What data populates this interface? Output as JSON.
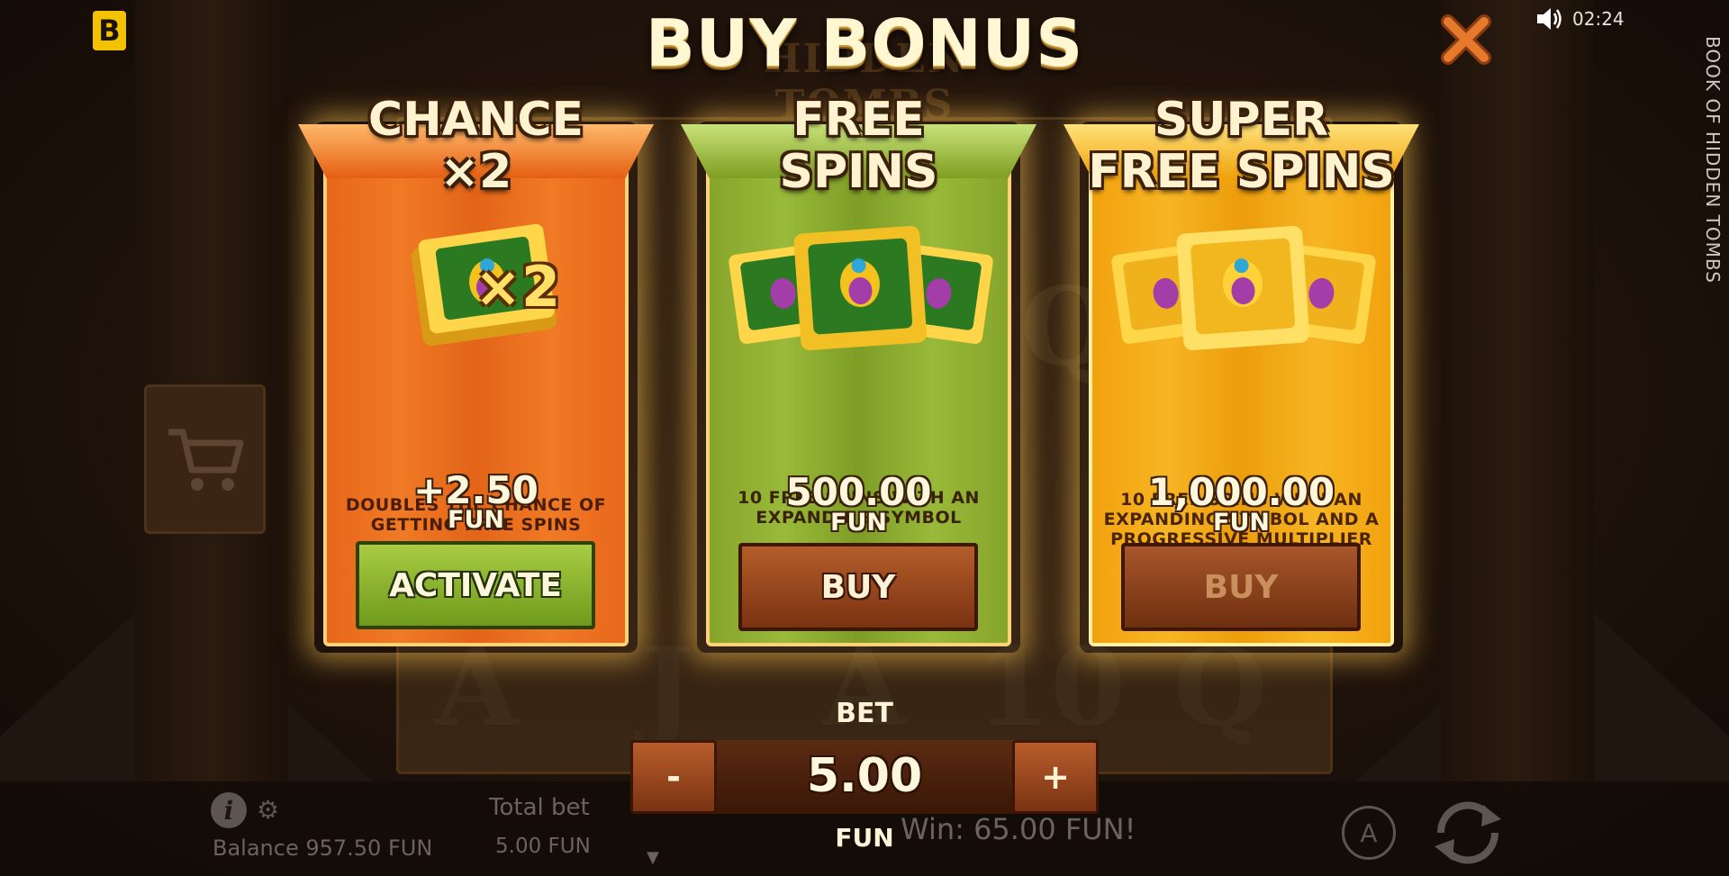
{
  "header": {
    "brand_letter": "B",
    "title": "BUY BONUS",
    "clock": "02:24",
    "game_name_vertical": "BOOK OF HIDDEN TOMBS"
  },
  "background": {
    "logo_text": "HIDDEN TOMBS",
    "reel_letters": [
      "A",
      "J",
      "A",
      "10",
      "Q",
      "Q"
    ]
  },
  "cards": [
    {
      "heading_line1": "CHANCE",
      "heading_line2": "×2",
      "art_badge": "×2",
      "description": "DOUBLES THE CHANCE OF GETTING FREE SPINS",
      "price": "+2.50",
      "currency": "FUN",
      "button_label": "ACTIVATE",
      "button_enabled": true,
      "accent": "#e8671b"
    },
    {
      "heading_line1": "FREE",
      "heading_line2": "SPINS",
      "description": "10 FREE SPINS WITH AN EXPANDING SYMBOL",
      "price": "500.00",
      "currency": "FUN",
      "button_label": "BUY",
      "button_enabled": true,
      "accent": "#86a52b"
    },
    {
      "heading_line1": "SUPER",
      "heading_line2": "FREE SPINS",
      "description": "10 FREE SPINS WITH AN EXPANDING SYMBOL AND A PROGRESSIVE MULTIPLIER",
      "price": "1,000.00",
      "currency": "FUN",
      "button_label": "BUY",
      "button_enabled": false,
      "accent": "#f2a20e"
    }
  ],
  "bet": {
    "label": "BET",
    "minus_label": "-",
    "plus_label": "+",
    "value": "5.00",
    "currency": "FUN"
  },
  "bottom_bar": {
    "balance": "Balance 957.50 FUN",
    "total_bet_label": "Total bet",
    "total_bet_value": "5.00 FUN",
    "win": "Win: 65.00 FUN!",
    "auto_label": "A"
  }
}
